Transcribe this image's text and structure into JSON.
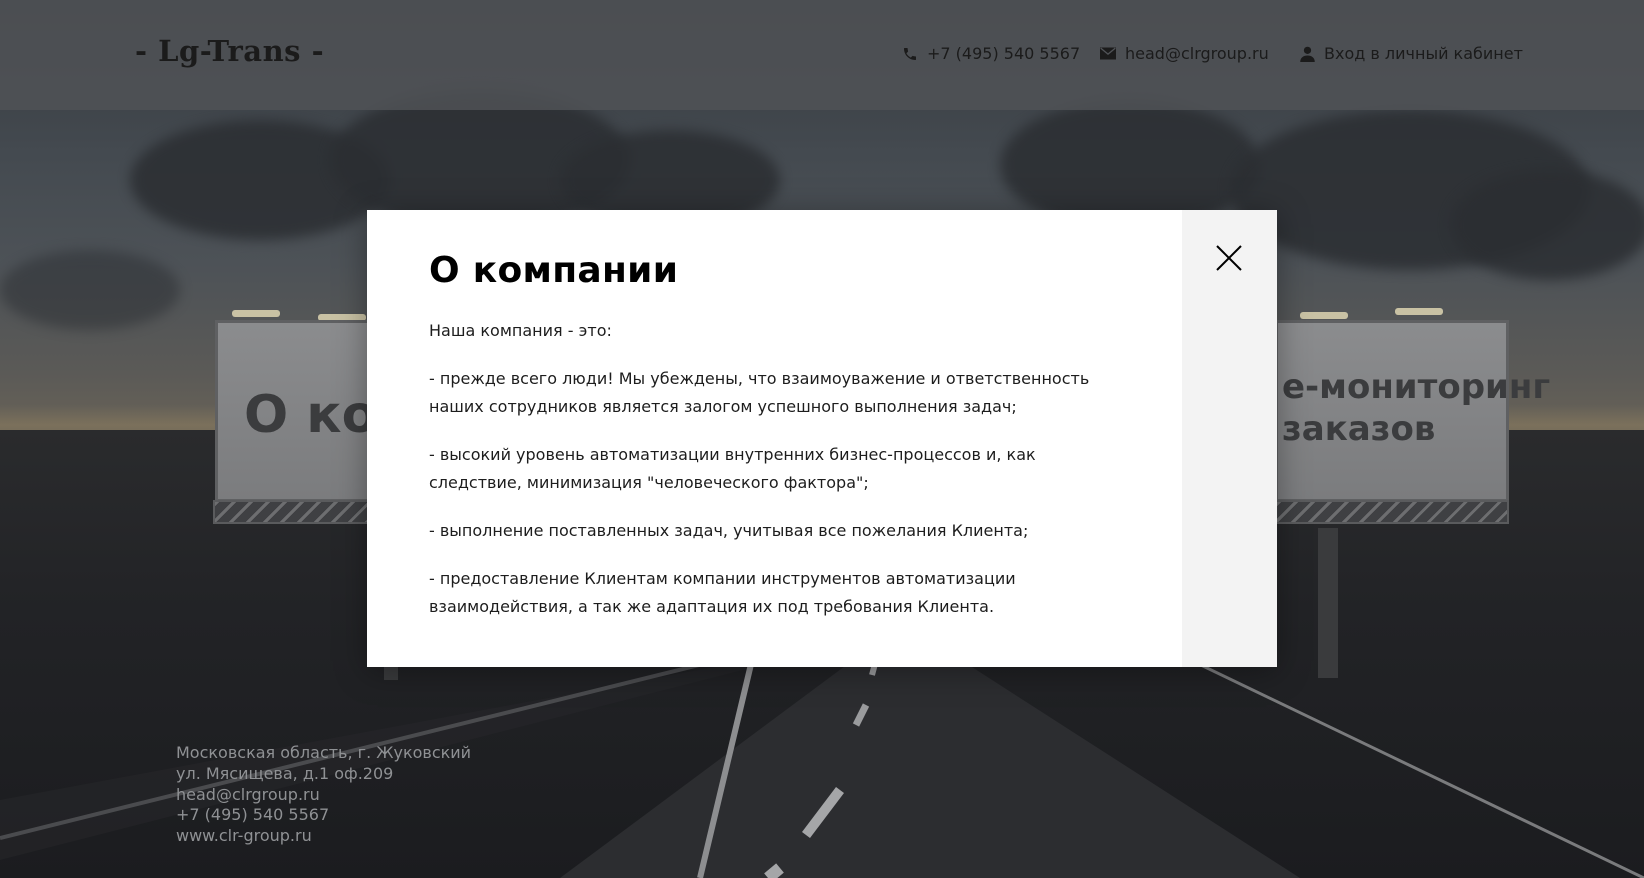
{
  "header": {
    "logo": "- Lg-Trans -",
    "phone": "+7 (495) 540 5567",
    "email": "head@clrgroup.ru",
    "login_label": "Вход в личный кабинет"
  },
  "background": {
    "billboard_left_text": "О ком",
    "billboard_right_line1": "е-мониторинг",
    "billboard_right_line2": "заказов"
  },
  "modal": {
    "title": "О компании",
    "paragraphs": [
      "Наша компания - это:",
      "- прежде всего люди! Мы убеждены, что взаимоуважение и ответственность наших сотрудников является залогом успешного выполнения задач;",
      "- высокий уровень автоматизации внутренних бизнес-процессов и, как следствие, минимизация \"человеческого фактора\";",
      "- выполнение поставленных задач, учитывая все пожелания Клиента;",
      "- предоставление Клиентам компании инструментов автоматизации взаимодействия, а так же адаптация их под требования Клиента."
    ]
  },
  "footer": {
    "address_line1": "Московская область, г. Жуковский",
    "address_line2": "ул. Мясищева, д.1 оф.209",
    "email": "head@clrgroup.ru",
    "phone": "+7 (495) 540 5567",
    "website": "www.clr-group.ru"
  },
  "colors": {
    "header_bg": "#505357",
    "modal_bg": "#ffffff",
    "modal_side_bg": "#f3f3f3",
    "footer_text": "#8f9194"
  }
}
